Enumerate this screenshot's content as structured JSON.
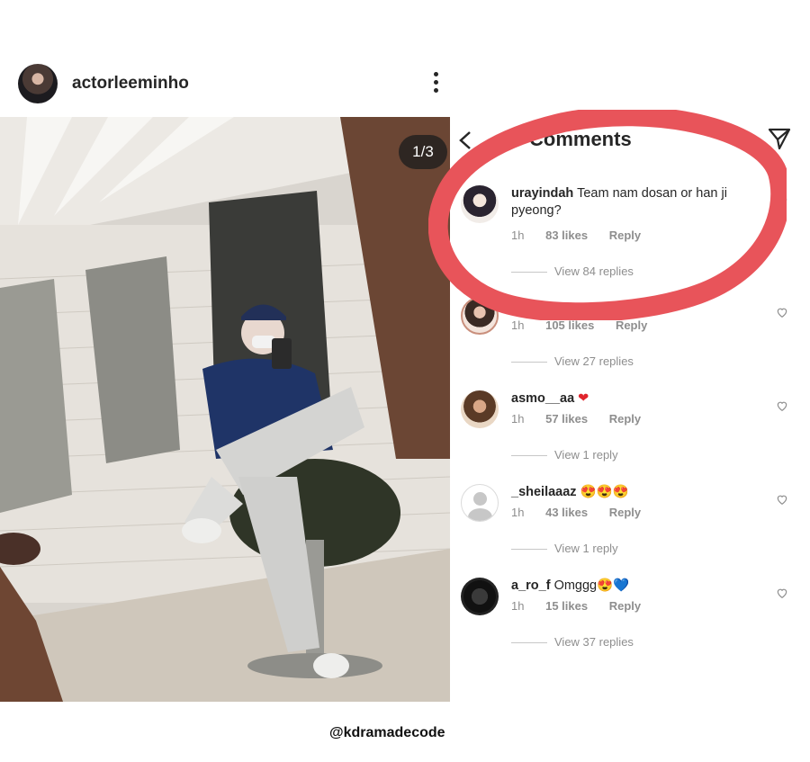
{
  "post": {
    "username": "actorleeminho",
    "image_counter": "1/3"
  },
  "comments_panel": {
    "title": "Comments",
    "comments": [
      {
        "user": "urayindah",
        "text": "Team nam dosan or han ji pyeong?",
        "time": "1h",
        "likes": "83 likes",
        "reply": "Reply",
        "view_replies": "View 84 replies"
      },
      {
        "user": "",
        "text": "",
        "time": "1h",
        "likes": "105 likes",
        "reply": "Reply",
        "view_replies": "View 27 replies"
      },
      {
        "user": "asmo__aa",
        "text": "",
        "emoji": "❤",
        "time": "1h",
        "likes": "57 likes",
        "reply": "Reply",
        "view_replies": "View 1 reply"
      },
      {
        "user": "_sheilaaaz",
        "text": "",
        "emoji": "😍😍😍",
        "time": "1h",
        "likes": "43 likes",
        "reply": "Reply",
        "view_replies": "View 1 reply"
      },
      {
        "user": "a_ro_f",
        "text": "Omggg",
        "emoji": "😍💙",
        "time": "1h",
        "likes": "15 likes",
        "reply": "Reply",
        "view_replies": "View 37 replies"
      }
    ]
  },
  "watermark": "@kdramadecode",
  "colors": {
    "highlight": "#e8545a",
    "meta_gray": "#8e8e8e",
    "text": "#262626"
  },
  "icons": [
    "more-vertical-icon",
    "back-arrow-icon",
    "send-icon",
    "heart-outline-icon"
  ]
}
